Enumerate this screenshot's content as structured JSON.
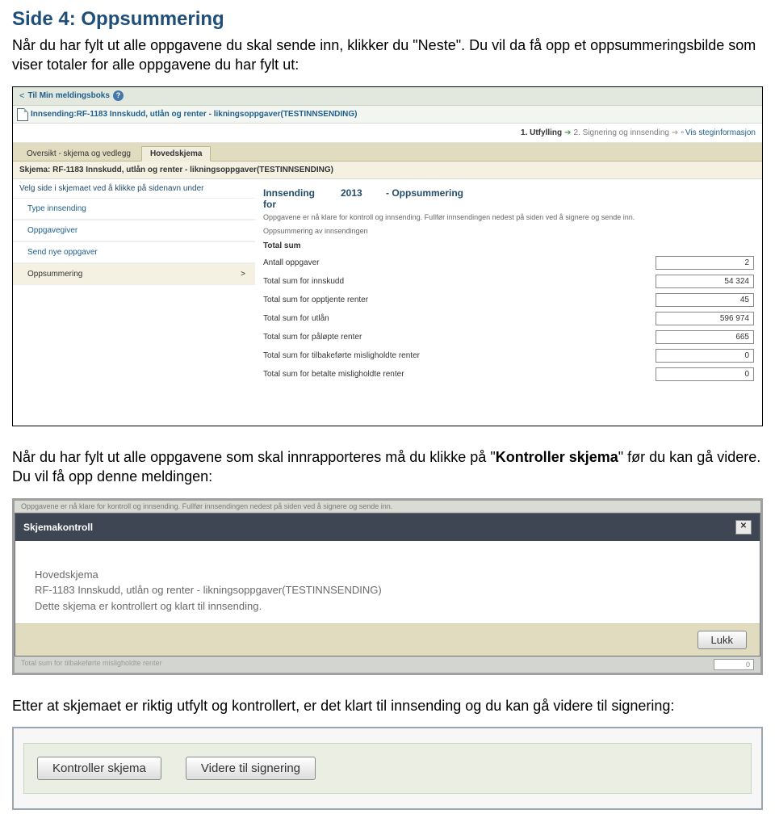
{
  "doc": {
    "heading": "Side 4: Oppsummering",
    "intro_1": "Når du har fylt ut alle oppgavene du skal sende inn, klikker du \"Neste\". Du vil da få opp et oppsummeringsbilde som viser totaler for alle oppgavene du har fylt ut:",
    "para2_a": "Når du har fylt ut alle oppgavene som skal innrapporteres må du klikke på \"",
    "para2_bold": "Kontroller skjema",
    "para2_b": "\" før du kan gå videre. Du vil få opp denne meldingen:",
    "para3": "Etter at skjemaet er riktig utfylt og kontrollert, er det klart til innsending og du kan gå videre til signering:"
  },
  "ss1": {
    "topbar_link": "Til Min meldingsboks",
    "title_prefix": "Innsending:",
    "title_link": "RF-1183 Innskudd, utlån og renter - likningsoppgaver(TESTINNSENDING)",
    "steps": {
      "current": "1. Utfylling",
      "next": "2. Signering og innsending",
      "steginfo": "Vis steginformasjon"
    },
    "tabs": {
      "oversikt": "Oversikt - skjema og vedlegg",
      "hoved": "Hovedskjema"
    },
    "subtitle": "Skjema: RF-1183 Innskudd, utlån og renter - likningsoppgaver(TESTINNSENDING)",
    "sidebar": {
      "hint": "Velg side i skjemaet ved å klikke på sidenavn under",
      "items": [
        "Type innsending",
        "Oppgavegiver",
        "Send nye oppgaver",
        "Oppsummering"
      ]
    },
    "main_head": {
      "left": "Innsending for",
      "mid": "2013",
      "right": "- Oppsummering"
    },
    "help1": "Oppgavene er nå klare for kontroll og innsending. Fullfør innsendingen nedest på siden ved å signere og sende inn.",
    "help2": "Oppsummering av innsendingen",
    "totalsum": "Total sum",
    "rows": [
      {
        "label": "Antall oppgaver",
        "value": "2"
      },
      {
        "label": "Total sum for innskudd",
        "value": "54 324"
      },
      {
        "label": "Total sum for opptjente renter",
        "value": "45"
      },
      {
        "label": "Total sum for utlån",
        "value": "596 974"
      },
      {
        "label": "Total sum for påløpte renter",
        "value": "665"
      },
      {
        "label": "Total sum for tilbakeførte misligholdte renter",
        "value": "0"
      },
      {
        "label": "Total sum for betalte misligholdte renter",
        "value": "0"
      }
    ]
  },
  "ss2": {
    "ghost_top": "Oppgavene er nå klare for kontroll og innsending. Fullfør innsendingen nedest på siden ved å signere og sende inn.",
    "modal_title": "Skjemakontroll",
    "body_l1": "Hovedskjema",
    "body_l2": "RF-1183 Innskudd, utlån og renter - likningsoppgaver(TESTINNSENDING)",
    "body_l3": "Dette skjema er kontrollert og klart til innsending.",
    "lukk": "Lukk",
    "ghost_bottom_label": "Total sum for tilbakeførte misligholdte renter",
    "ghost_bottom_value": "0"
  },
  "ss3": {
    "btn_kontroller": "Kontroller skjema",
    "btn_videre": "Videre til signering"
  }
}
